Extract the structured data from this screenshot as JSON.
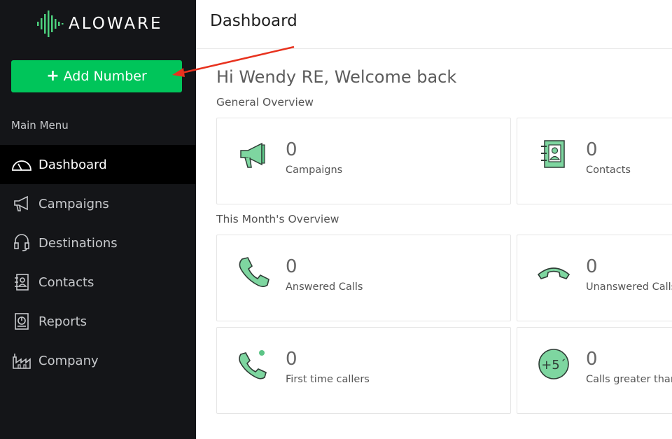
{
  "brand": {
    "logo_text": "ALOWARE"
  },
  "sidebar": {
    "add_number_label": "Add Number",
    "menu_heading": "Main Menu",
    "items": [
      {
        "label": "Dashboard",
        "icon": "dashboard-gauge-icon",
        "active": true
      },
      {
        "label": "Campaigns",
        "icon": "megaphone-icon"
      },
      {
        "label": "Destinations",
        "icon": "headset-icon"
      },
      {
        "label": "Contacts",
        "icon": "contact-book-icon"
      },
      {
        "label": "Reports",
        "icon": "report-icon"
      },
      {
        "label": "Company",
        "icon": "factory-icon"
      }
    ]
  },
  "header": {
    "title": "Dashboard"
  },
  "main": {
    "welcome": "Hi Wendy RE, Welcome back",
    "general_overview": {
      "label": "General Overview",
      "cards": [
        {
          "value": "0",
          "label": "Campaigns",
          "icon": "megaphone-icon"
        },
        {
          "value": "0",
          "label": "Contacts",
          "icon": "contact-book-icon"
        }
      ]
    },
    "month_overview": {
      "label": "This Month's Overview",
      "cards": [
        {
          "value": "0",
          "label": "Answered Calls",
          "icon": "phone-icon"
        },
        {
          "value": "0",
          "label": "Unanswered Calls",
          "icon": "hang-up-icon"
        },
        {
          "value": "0",
          "label": "First time callers",
          "icon": "phone-new-icon"
        },
        {
          "value": "0",
          "label": "Calls greater than",
          "icon": "plus-five-minutes-icon",
          "icon_text": "+5´"
        }
      ]
    }
  },
  "colors": {
    "accent": "#00c55a",
    "sidebar_bg": "#141518",
    "icon_green": "#7ed6a0",
    "annotation_arrow": "#e8321e"
  }
}
